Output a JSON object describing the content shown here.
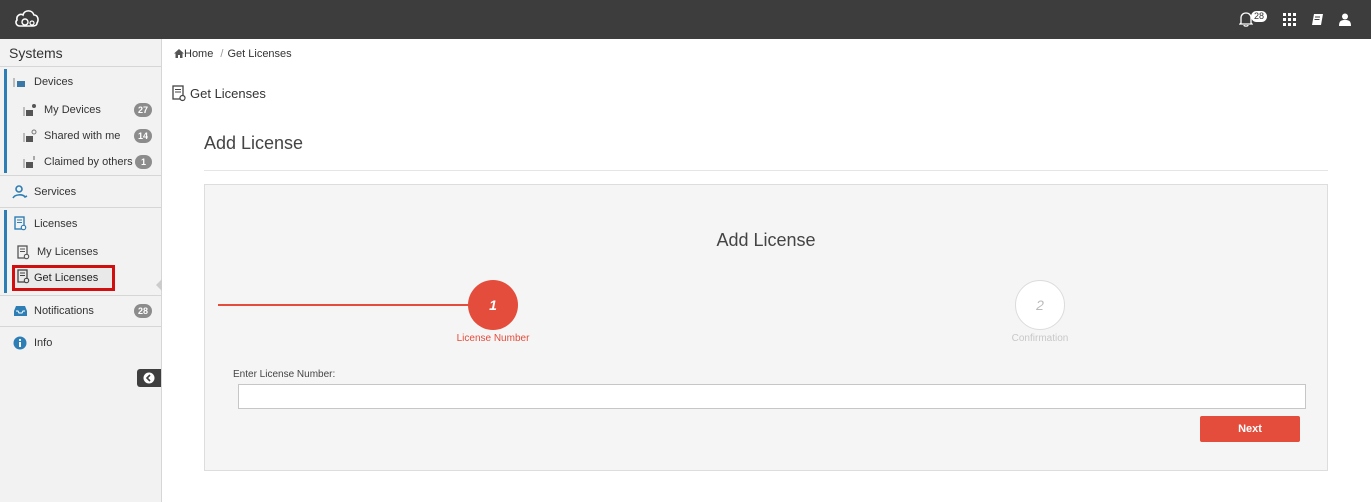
{
  "topbar": {
    "notification_count": "28",
    "icons": [
      "cloud-gear-logo-icon",
      "bell-icon",
      "grid-icon",
      "book-icon",
      "user-icon"
    ]
  },
  "sidebar": {
    "title": "Systems",
    "devices": {
      "label": "Devices",
      "items": [
        {
          "label": "My Devices",
          "badge": "27"
        },
        {
          "label": "Shared with me",
          "badge": "14"
        },
        {
          "label": "Claimed by others",
          "badge": "1"
        }
      ]
    },
    "services": {
      "label": "Services"
    },
    "licenses": {
      "label": "Licenses",
      "items": [
        {
          "label": "My Licenses"
        },
        {
          "label": "Get Licenses"
        }
      ]
    },
    "notifications": {
      "label": "Notifications",
      "badge": "28"
    },
    "info": {
      "label": "Info"
    }
  },
  "breadcrumb": {
    "home": "Home",
    "separator": "/",
    "current": "Get Licenses"
  },
  "page": {
    "heading": "Get Licenses",
    "section_title": "Add License"
  },
  "wizard": {
    "title": "Add License",
    "steps": [
      {
        "number": "1",
        "label": "License Number",
        "state": "active"
      },
      {
        "number": "2",
        "label": "Confirmation",
        "state": "inactive"
      }
    ],
    "field_label": "Enter License Number:",
    "field_value": "",
    "next_label": "Next"
  },
  "colors": {
    "accent": "#e44c3b",
    "topbar": "#3d3d3d",
    "sidebar_active": "#2e7eb6",
    "highlight_box": "#d20f0f"
  }
}
